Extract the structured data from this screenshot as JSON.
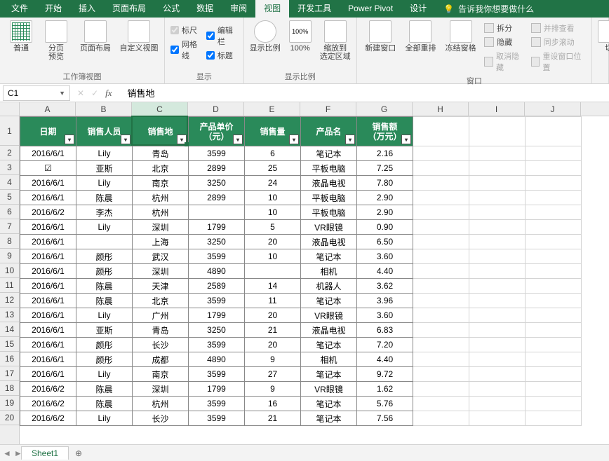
{
  "menu": [
    "文件",
    "开始",
    "插入",
    "页面布局",
    "公式",
    "数据",
    "审阅",
    "视图",
    "开发工具",
    "Power Pivot",
    "设计"
  ],
  "menu_active_index": 7,
  "tell_me": "告诉我你想要做什么",
  "ribbon": {
    "views": {
      "normal": "普通",
      "page_break": "分页\n预览",
      "page_layout": "页面布局",
      "custom": "自定义视图",
      "group": "工作簿视图"
    },
    "show": {
      "ruler": "标尺",
      "formula_bar": "编辑栏",
      "gridlines": "网格线",
      "headings": "标题",
      "group": "显示"
    },
    "zoom": {
      "zoom": "显示比例",
      "hundred": "100%",
      "to_selection": "缩放到\n选定区域",
      "group": "显示比例"
    },
    "window": {
      "new": "新建窗口",
      "arrange": "全部重排",
      "freeze": "冻结窗格",
      "split": "拆分",
      "hide": "隐藏",
      "unhide": "取消隐藏",
      "side": "并排查看",
      "sync": "同步滚动",
      "reset": "重设窗口位置",
      "group": "窗口"
    },
    "switch": "切"
  },
  "namebox": "C1",
  "formula": "销售地",
  "columns": [
    "A",
    "B",
    "C",
    "D",
    "E",
    "F",
    "G",
    "H",
    "I",
    "J"
  ],
  "headers": [
    "日期",
    "销售人员",
    "销售地",
    "产品单价\n（元）",
    "销售量",
    "产品名",
    "销售额\n（万元）"
  ],
  "rows": [
    [
      "2016/6/1",
      "Lily",
      "青岛",
      "3599",
      "6",
      "笔记本",
      "2.16"
    ],
    [
      "☑",
      "亚斯",
      "北京",
      "2899",
      "25",
      "平板电脑",
      "7.25"
    ],
    [
      "2016/6/1",
      "Lily",
      "南京",
      "3250",
      "24",
      "液晶电视",
      "7.80"
    ],
    [
      "2016/6/1",
      "陈晨",
      "杭州",
      "2899",
      "10",
      "平板电脑",
      "2.90"
    ],
    [
      "2016/6/2",
      "李杰",
      "杭州",
      "",
      "10",
      "平板电脑",
      "2.90"
    ],
    [
      "2016/6/1",
      "Lily",
      "深圳",
      "1799",
      "5",
      "VR眼镜",
      "0.90"
    ],
    [
      "2016/6/1",
      "",
      "上海",
      "3250",
      "20",
      "液晶电视",
      "6.50"
    ],
    [
      "2016/6/1",
      "颜彤",
      "武汉",
      "3599",
      "10",
      "笔记本",
      "3.60"
    ],
    [
      "2016/6/1",
      "颜彤",
      "深圳",
      "4890",
      "",
      "相机",
      "4.40"
    ],
    [
      "2016/6/1",
      "陈晨",
      "天津",
      "2589",
      "14",
      "机器人",
      "3.62"
    ],
    [
      "2016/6/1",
      "陈晨",
      "北京",
      "3599",
      "11",
      "笔记本",
      "3.96"
    ],
    [
      "2016/6/1",
      "Lily",
      "广州",
      "1799",
      "20",
      "VR眼镜",
      "3.60"
    ],
    [
      "2016/6/1",
      "亚斯",
      "青岛",
      "3250",
      "21",
      "液晶电视",
      "6.83"
    ],
    [
      "2016/6/1",
      "颜彤",
      "长沙",
      "3599",
      "20",
      "笔记本",
      "7.20"
    ],
    [
      "2016/6/1",
      "颜彤",
      "成都",
      "4890",
      "9",
      "相机",
      "4.40"
    ],
    [
      "2016/6/1",
      "Lily",
      "南京",
      "3599",
      "27",
      "笔记本",
      "9.72"
    ],
    [
      "2016/6/2",
      "陈晨",
      "深圳",
      "1799",
      "9",
      "VR眼镜",
      "1.62"
    ],
    [
      "2016/6/2",
      "陈晨",
      "杭州",
      "3599",
      "16",
      "笔记本",
      "5.76"
    ],
    [
      "2016/6/2",
      "Lily",
      "长沙",
      "3599",
      "21",
      "笔记本",
      "7.56"
    ]
  ],
  "sheet_tab": "Sheet1"
}
